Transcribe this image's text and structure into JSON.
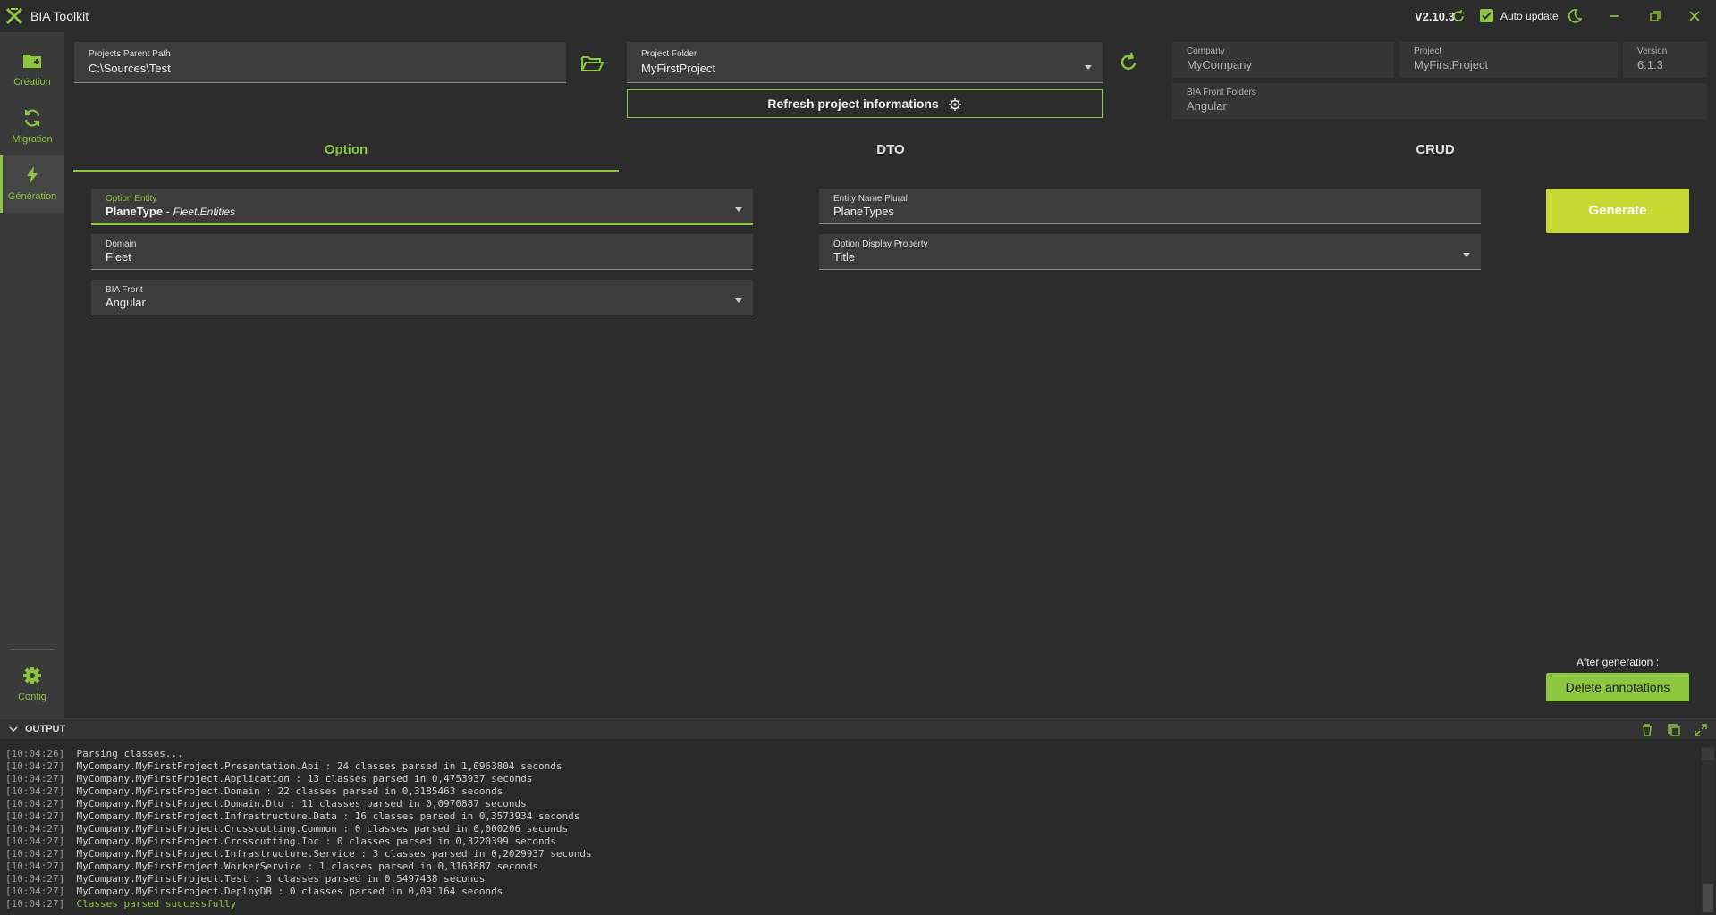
{
  "window": {
    "title": "BIA Toolkit",
    "version": "V2.10.3",
    "auto_update_label": "Auto update",
    "accent": "#8dc63f"
  },
  "sidebar": {
    "items": [
      {
        "label": "Création",
        "icon": "folder-plus-icon"
      },
      {
        "label": "Migration",
        "icon": "sync-icon"
      },
      {
        "label": "Génération",
        "icon": "bolt-icon"
      }
    ],
    "config": {
      "label": "Config",
      "icon": "gear-icon"
    }
  },
  "project": {
    "parent_path_label": "Projects Parent Path",
    "parent_path_value": "C:\\Sources\\Test",
    "folder_label": "Project Folder",
    "folder_value": "MyFirstProject",
    "refresh_button": "Refresh project informations"
  },
  "info": {
    "company_label": "Company",
    "company_value": "MyCompany",
    "project_label": "Project",
    "project_value": "MyFirstProject",
    "version_label": "Version",
    "version_value": "6.1.3",
    "front_folders_label": "BIA Front Folders",
    "front_folders_value": "Angular"
  },
  "tabs": [
    {
      "label": "Option",
      "active": true
    },
    {
      "label": "DTO",
      "active": false
    },
    {
      "label": "CRUD",
      "active": false
    }
  ],
  "form": {
    "option_entity_label": "Option Entity",
    "option_entity_name": "PlaneType",
    "option_entity_sep": " - ",
    "option_entity_ns": "Fleet.Entities",
    "domain_label": "Domain",
    "domain_value": "Fleet",
    "bia_front_label": "BIA Front",
    "bia_front_value": "Angular",
    "entity_plural_label": "Entity Name Plural",
    "entity_plural_value": "PlaneTypes",
    "display_property_label": "Option Display Property",
    "display_property_value": "Title",
    "generate_button": "Generate",
    "after_generation_label": "After generation :",
    "delete_annotations_button": "Delete annotations"
  },
  "output": {
    "title": "OUTPUT",
    "lines": [
      {
        "time": "[10:04:26]",
        "msg": "Parsing classes..."
      },
      {
        "time": "[10:04:27]",
        "msg": "MyCompany.MyFirstProject.Presentation.Api : 24 classes parsed in 1,0963804 seconds"
      },
      {
        "time": "[10:04:27]",
        "msg": "MyCompany.MyFirstProject.Application : 13 classes parsed in 0,4753937 seconds"
      },
      {
        "time": "[10:04:27]",
        "msg": "MyCompany.MyFirstProject.Domain : 22 classes parsed in 0,3185463 seconds"
      },
      {
        "time": "[10:04:27]",
        "msg": "MyCompany.MyFirstProject.Domain.Dto : 11 classes parsed in 0,0970887 seconds"
      },
      {
        "time": "[10:04:27]",
        "msg": "MyCompany.MyFirstProject.Infrastructure.Data : 16 classes parsed in 0,3573934 seconds"
      },
      {
        "time": "[10:04:27]",
        "msg": "MyCompany.MyFirstProject.Crosscutting.Common : 0 classes parsed in 0,000206 seconds"
      },
      {
        "time": "[10:04:27]",
        "msg": "MyCompany.MyFirstProject.Crosscutting.Ioc : 0 classes parsed in 0,3220399 seconds"
      },
      {
        "time": "[10:04:27]",
        "msg": "MyCompany.MyFirstProject.Infrastructure.Service : 3 classes parsed in 0,2029937 seconds"
      },
      {
        "time": "[10:04:27]",
        "msg": "MyCompany.MyFirstProject.WorkerService : 1 classes parsed in 0,3163887 seconds"
      },
      {
        "time": "[10:04:27]",
        "msg": "MyCompany.MyFirstProject.Test : 3 classes parsed in 0,5497438 seconds"
      },
      {
        "time": "[10:04:27]",
        "msg": "MyCompany.MyFirstProject.DeployDB : 0 classes parsed in 0,091164 seconds"
      },
      {
        "time": "[10:04:27]",
        "msg": "Classes parsed successfully",
        "success": true
      }
    ]
  }
}
